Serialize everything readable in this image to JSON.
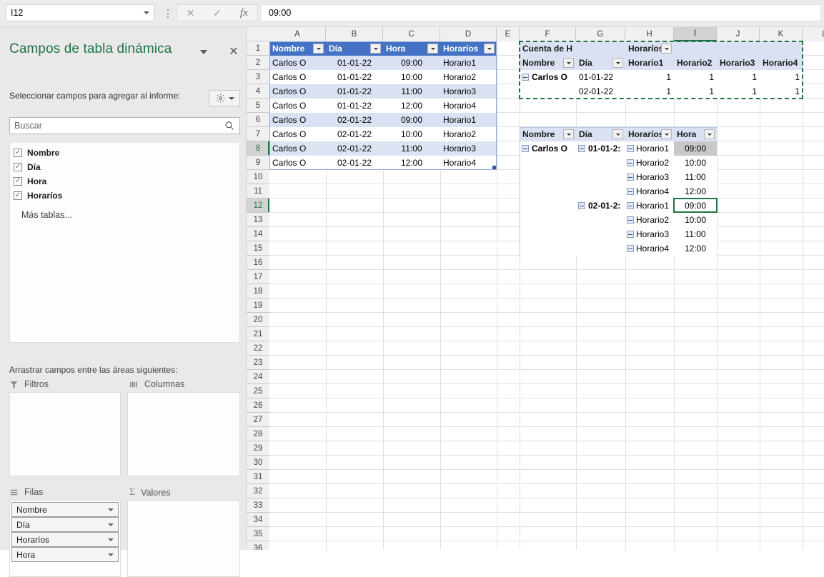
{
  "formula_bar": {
    "name_box_value": "I12",
    "name_box_icon": "chevron-down-icon",
    "cancel_icon": "close-icon",
    "confirm_icon": "check-icon",
    "function_icon": "fx",
    "formula_value": "09:00"
  },
  "pivot_panel": {
    "title": "Campos de tabla dinámica",
    "collapse_icon": "chevron-down-icon",
    "close_icon": "close-icon",
    "subtitle": "Seleccionar campos para agregar al informe:",
    "gear_icon": "gear-icon",
    "gear_caret_icon": "chevron-down-icon",
    "search_placeholder": "Buscar",
    "search_icon": "search-icon",
    "fields": [
      {
        "label": "Nombre",
        "checked": true
      },
      {
        "label": "Día",
        "checked": true
      },
      {
        "label": "Hora",
        "checked": true
      },
      {
        "label": "Horaríos",
        "checked": true
      }
    ],
    "more_tables": "Más tablas...",
    "drag_label": "Arrastrar campos entre las áreas siguientes:",
    "areas": [
      {
        "name": "Filtros",
        "icon": "filter-icon",
        "items": []
      },
      {
        "name": "Columnas",
        "icon": "columns-icon",
        "items": []
      },
      {
        "name": "Filas",
        "icon": "rows-icon",
        "items": [
          "Nombre",
          "Día",
          "Horaríos",
          "Hora"
        ]
      },
      {
        "name": "Valores",
        "icon": "sigma-icon",
        "items": []
      }
    ]
  },
  "grid": {
    "columns": [
      "A",
      "B",
      "C",
      "D",
      "E",
      "F",
      "G",
      "H",
      "I",
      "J",
      "K",
      "L"
    ],
    "active_column": "I",
    "active_row": 12,
    "selected_row": 8,
    "rows": [
      1,
      2,
      3,
      4,
      5,
      6,
      7,
      8,
      9,
      10,
      11,
      12,
      13,
      14,
      15,
      16,
      17,
      18,
      19,
      20,
      21,
      22,
      23,
      24,
      25,
      26,
      27,
      28,
      29,
      30,
      31,
      32,
      33,
      34,
      35,
      36
    ]
  },
  "source_table": {
    "headers": [
      "Nombre",
      "Día",
      "Hora",
      "Horaríos"
    ],
    "filter_icon": "chevron-down-icon",
    "rows": [
      [
        "Carlos O",
        "01-01-22",
        "09:00",
        "Horario1"
      ],
      [
        "Carlos O",
        "01-01-22",
        "10:00",
        "Horario2"
      ],
      [
        "Carlos O",
        "01-01-22",
        "11:00",
        "Horario3"
      ],
      [
        "Carlos O",
        "01-01-22",
        "12:00",
        "Horario4"
      ],
      [
        "Carlos O",
        "02-01-22",
        "09:00",
        "Horario1"
      ],
      [
        "Carlos O",
        "02-01-22",
        "10:00",
        "Horario2"
      ],
      [
        "Carlos O",
        "02-01-22",
        "11:00",
        "Horario3"
      ],
      [
        "Carlos O",
        "02-01-22",
        "12:00",
        "Horario4"
      ]
    ]
  },
  "pivot_table_1": {
    "value_title": "Cuenta de H",
    "column_field_label": "Horaríos",
    "column_field_icon": "chevron-down-icon",
    "row_headers": [
      "Nombre",
      "Día"
    ],
    "row_header_icon": "chevron-down-icon",
    "column_headers": [
      "Horario1",
      "Horario2",
      "Horario3",
      "Horario4"
    ],
    "rows": [
      {
        "name": "Carlos O",
        "expand_icon": "collapse-minus-icon",
        "day": "01-01-22",
        "values": [
          "1",
          "1",
          "1",
          "1"
        ]
      },
      {
        "name": "",
        "expand_icon": "",
        "day": "02-01-22",
        "values": [
          "1",
          "1",
          "1",
          "1"
        ]
      }
    ]
  },
  "pivot_table_2": {
    "headers": [
      "Nombre",
      "Día",
      "Horaríos",
      "Hora"
    ],
    "header_icon": "chevron-down-icon",
    "expand_icon": "collapse-minus-icon",
    "rows": [
      {
        "name": "Carlos O",
        "day": "01-01-2:",
        "horario": "Horario1",
        "hora": "09:00",
        "state": "selected"
      },
      {
        "name": "",
        "day": "",
        "horario": "Horario2",
        "hora": "10:00",
        "state": ""
      },
      {
        "name": "",
        "day": "",
        "horario": "Horario3",
        "hora": "11:00",
        "state": ""
      },
      {
        "name": "",
        "day": "",
        "horario": "Horario4",
        "hora": "12:00",
        "state": ""
      },
      {
        "name": "",
        "day": "02-01-2:",
        "horario": "Horario1",
        "hora": "09:00",
        "state": "active"
      },
      {
        "name": "",
        "day": "",
        "horario": "Horario2",
        "hora": "10:00",
        "state": ""
      },
      {
        "name": "",
        "day": "",
        "horario": "Horario3",
        "hora": "11:00",
        "state": ""
      },
      {
        "name": "",
        "day": "",
        "horario": "Horario4",
        "hora": "12:00",
        "state": ""
      }
    ]
  },
  "colors": {
    "excel_green": "#217346",
    "table_header_blue": "#4472c4",
    "table_band_blue": "#d9e1f2",
    "pivot_header_blue": "#d9e1f2"
  }
}
